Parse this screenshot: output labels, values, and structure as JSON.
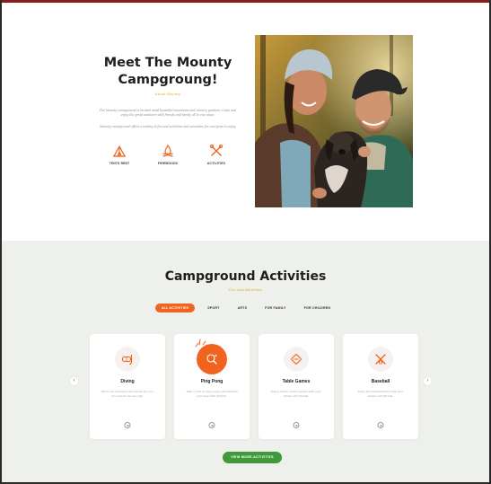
{
  "hero": {
    "title": "Meet The Mounty Campgroung!",
    "subtitle": "About Mounty",
    "paragraph1": "The Mounty campground is located amid beautiful mountains and country gardens. Come and enjoy the great outdoors with friends and family all in one place.",
    "paragraph2": "Mounty campground offers a variety of fun and activities and amenities for everyone to enjoy.",
    "features": [
      {
        "label": "TENTS RENT",
        "icon": "tent-icon"
      },
      {
        "label": "FIREWOODS",
        "icon": "campfire-icon"
      },
      {
        "label": "ACTIVITIES",
        "icon": "crossed-tools-icon"
      }
    ],
    "photo": "couple-with-dog-photo"
  },
  "activities": {
    "title": "Campground Activities",
    "subtitle": "Fun and Activities",
    "tabs": [
      {
        "label": "ALL ACTIVITIES",
        "active": true
      },
      {
        "label": "SPORT",
        "active": false
      },
      {
        "label": "ARTS",
        "active": false
      },
      {
        "label": "FOR FAMILY",
        "active": false
      },
      {
        "label": "FOR CHILDREN",
        "active": false
      }
    ],
    "cards": [
      {
        "title": "Diving",
        "icon": "diving-mask-icon",
        "desc": "There are amazing lake places for you. Go explore the sea life."
      },
      {
        "title": "Ping Pong",
        "icon": "ping-pong-icon",
        "desc": "Take a part in ping pong tournaments and play with friends."
      },
      {
        "title": "Table Games",
        "icon": "dice-icon",
        "desc": "Enjoy classic board games with your family and friends."
      },
      {
        "title": "Baseball",
        "icon": "baseball-icon",
        "desc": "Enjoy the baseball field with your family and friends."
      }
    ],
    "all_button": "VIEW MORE ACTIVITIES",
    "prev_arrow": "‹",
    "next_arrow": "›"
  },
  "colors": {
    "accent_orange": "#f0641f",
    "accent_yellow": "#e8a317",
    "button_green": "#3e9a3a",
    "section_bg": "#eef0eb"
  }
}
